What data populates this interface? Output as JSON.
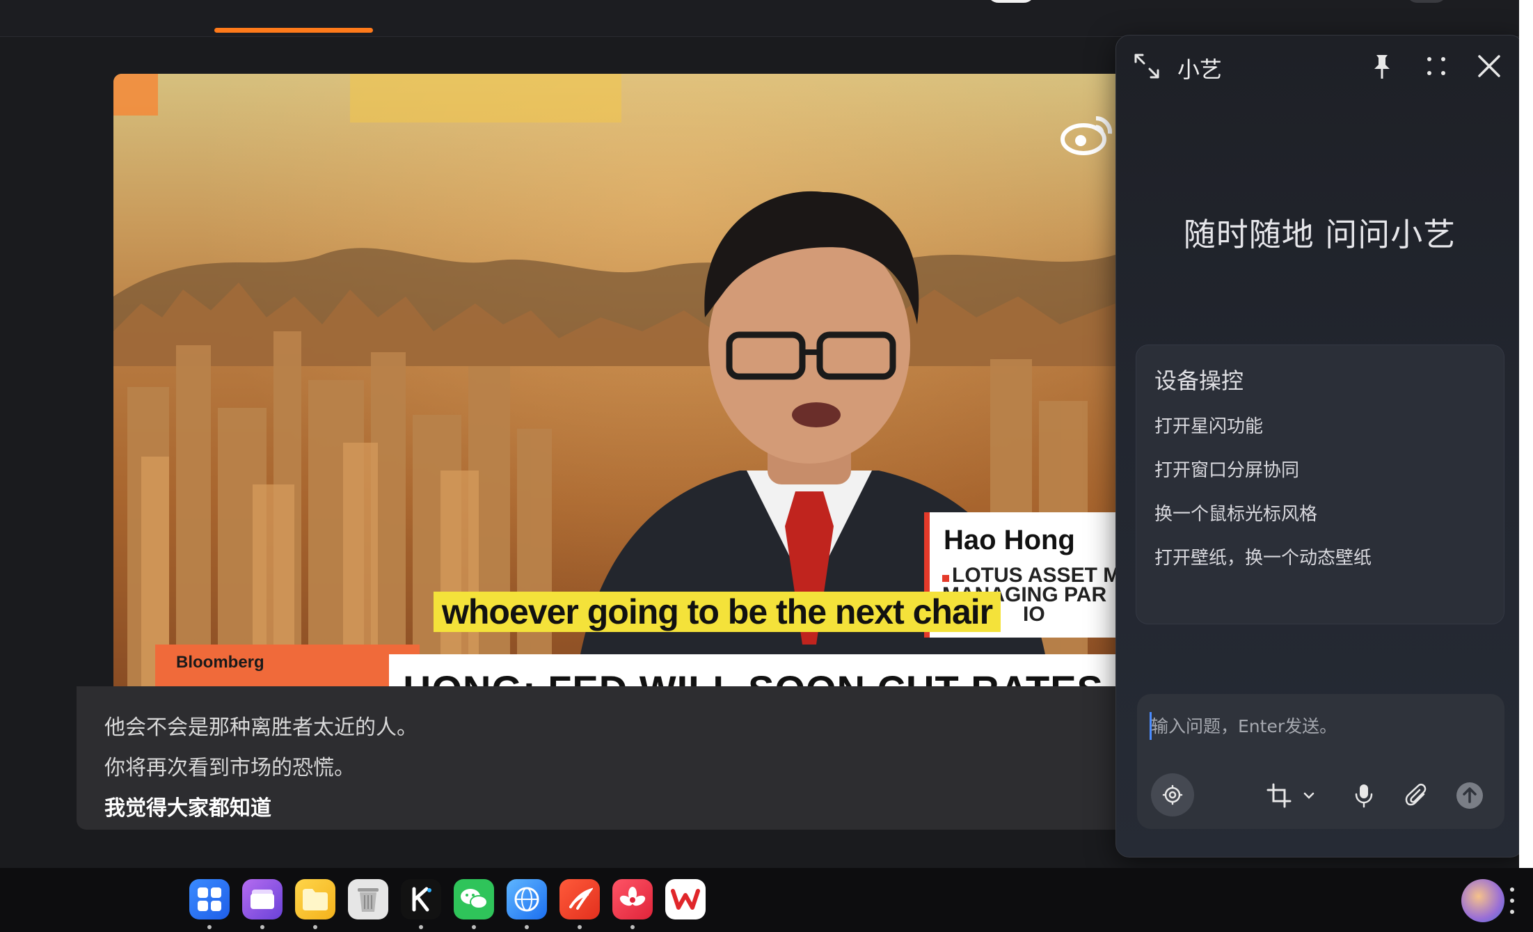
{
  "video": {
    "caption_en": "whoever going to be the next chair",
    "lower_third": {
      "name": "Hao Hong",
      "line1": "LOTUS ASSET M",
      "line2": "MANAGING PAR",
      "line3": "IO"
    },
    "brand": "Bloomberg",
    "ticker": "HONG: FED WILL SOON CUT RATES A"
  },
  "subtitles": [
    "他会不会是那种离胜者太近的人。",
    "你将再次看到市场的恐慌。",
    "我觉得大家都知道"
  ],
  "assistant": {
    "title": "小艺",
    "hero": "随时随地 问问小艺",
    "card": {
      "title": "设备操控",
      "items": [
        "打开星闪功能",
        "打开窗口分屏协同",
        "换一个鼠标光标风格",
        "打开壁纸，换一个动态壁纸"
      ]
    },
    "input": {
      "placeholder": "输入问题，Enter发送。",
      "value": ""
    }
  },
  "colors": {
    "accent_orange": "#ff7a1a",
    "panel_bg": "#22262f",
    "caption_yellow": "#f4e23a",
    "caret_blue": "#4a8cff"
  },
  "dock": [
    {
      "icon": "launcher-grid-icon",
      "running": true
    },
    {
      "icon": "multitask-window-icon",
      "running": true
    },
    {
      "icon": "file-manager-folder-icon",
      "running": true
    },
    {
      "icon": "recycle-bin-icon",
      "running": false
    },
    {
      "icon": "k-app-icon",
      "running": true
    },
    {
      "icon": "wechat-icon",
      "running": true
    },
    {
      "icon": "browser-icon",
      "running": true
    },
    {
      "icon": "swift-app-icon",
      "running": true
    },
    {
      "icon": "huawei-app-icon",
      "running": true
    },
    {
      "icon": "wps-office-icon",
      "running": false
    }
  ]
}
